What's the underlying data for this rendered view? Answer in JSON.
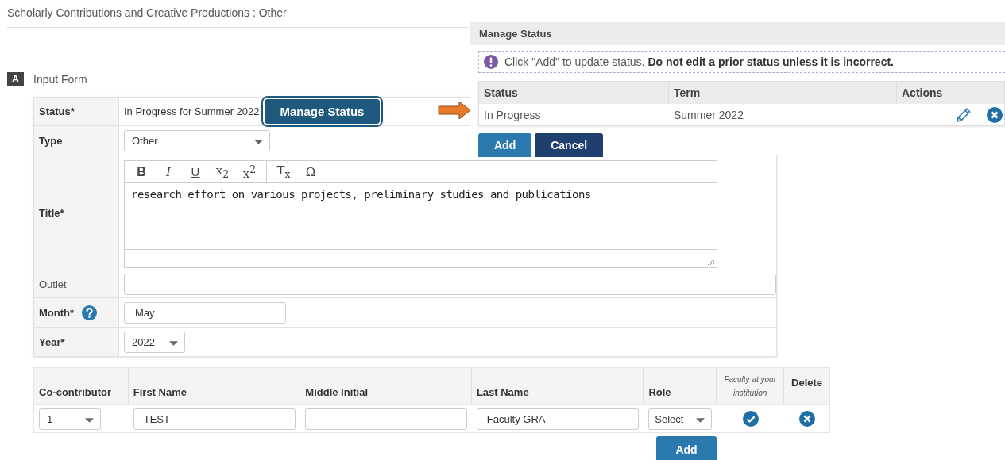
{
  "page": {
    "title": "Scholarly Contributions and Creative Productions : Other"
  },
  "section": {
    "badge": "A",
    "title": "Input Form"
  },
  "form": {
    "fields": [
      {
        "kind": "status",
        "label": "Status*",
        "value": "In Progress for Summer 2022",
        "button": "Manage Status"
      },
      {
        "kind": "select",
        "label": "Type",
        "value": "Other"
      },
      {
        "kind": "editor",
        "label": "Title*",
        "value": "research effort on various projects, preliminary studies and publications",
        "toolbar": [
          [
            {
              "kind": "bold",
              "label": "B"
            },
            {
              "kind": "italic",
              "label": "I"
            },
            {
              "kind": "underline",
              "label": "U"
            },
            {
              "kind": "plain",
              "label": "x$_{2}$"
            },
            {
              "kind": "plain",
              "label": "x$^{2}$"
            }
          ],
          [
            {
              "kind": "plain",
              "label": "T$_{x}$"
            },
            {
              "kind": "plain",
              "label": "Ω"
            }
          ]
        ]
      },
      {
        "kind": "text",
        "label": "Outlet"
      },
      {
        "kind": "text",
        "label": "Month*",
        "value": "May",
        "help": true
      },
      {
        "kind": "select",
        "label": "Year*",
        "value": "2022"
      }
    ]
  },
  "dialog": {
    "title": "Manage Status",
    "notice": "Click \"Add\" to update status. **Do not edit a prior status unless it is incorrect.**",
    "columns": [
      "Status",
      "Term",
      "Actions"
    ],
    "rows": [
      {
        "status": "In Progress",
        "term": "Summer 2022"
      }
    ],
    "buttons": [
      {
        "kind": "primary",
        "label": "Add"
      },
      {
        "kind": "secondary",
        "label": "Cancel"
      }
    ]
  },
  "contributors": {
    "columns": [
      "Co-contributor",
      "First Name",
      "Middle Initial",
      "Last Name",
      "Role",
      "Faculty at your institution",
      "Delete"
    ],
    "rows": [
      {
        "number": "1",
        "first_name": "TEST",
        "last_name": "Faculty GRA",
        "role": "Select",
        "faculty_at_institution": true
      }
    ],
    "add_button": "Add"
  }
}
